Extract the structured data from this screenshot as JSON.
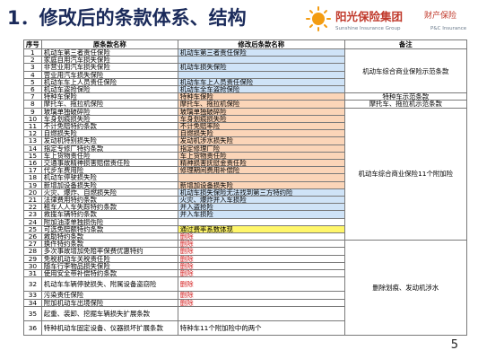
{
  "slide": {
    "title": "1．修改后的条款体系、结构",
    "page_number": "5"
  },
  "logo": {
    "name_cn": "阳光保险集团",
    "sub_cn": "财产保险",
    "name_en": "Sunshine Insurance Group",
    "sub_en": "P&C Insurance",
    "colors": {
      "red": "#c0392b",
      "orange": "#f39c12"
    }
  },
  "table": {
    "headers": [
      "序号",
      "原条款名称",
      "修改后条款名称",
      "备注"
    ],
    "rows": [
      {
        "num": "1",
        "orig": "机动车第三者责任保险",
        "new": "机动车第三者责任保险",
        "style": "blue"
      },
      {
        "num": "2",
        "orig": "家庭自用汽车损失保险",
        "new": "",
        "style": "blue"
      },
      {
        "num": "3",
        "orig": "非营业用汽车损失保险",
        "new": "机动车损失保险",
        "style": "blue"
      },
      {
        "num": "4",
        "orig": "营业用汽车损失保险",
        "new": "",
        "style": "blue"
      },
      {
        "num": "5",
        "orig": "机动车车上人员责任保险",
        "new": "机动车车上人员责任保险",
        "style": "blue"
      },
      {
        "num": "6",
        "orig": "机动车盗抢保险",
        "new": "机动车全车盗抢保险",
        "style": "blue"
      },
      {
        "num": "7",
        "orig": "特种车保险",
        "new": "特种车保险",
        "style": "peach"
      },
      {
        "num": "8",
        "orig": "摩托车、拖拉机保险",
        "new": "摩托车、拖拉机保险",
        "style": "peach"
      },
      {
        "num": "9",
        "orig": "玻璃单独破碎险",
        "new": "玻璃单独破碎险",
        "style": "peach"
      },
      {
        "num": "10",
        "orig": "车身划痕损失险",
        "new": "车身划痕损失险",
        "style": "peach"
      },
      {
        "num": "11",
        "orig": "不计免赔特约条款",
        "new": "不计免赔率险",
        "style": "peach"
      },
      {
        "num": "12",
        "orig": "自燃损失险",
        "new": "自燃损失险",
        "style": "peach"
      },
      {
        "num": "13",
        "orig": "发动机特别损失险",
        "new": "发动机涉水损失险",
        "style": "peach"
      },
      {
        "num": "14",
        "orig": "指定专修厂特约条款",
        "new": "指定修理厂险",
        "style": "peach"
      },
      {
        "num": "15",
        "orig": "车上货物责任险",
        "new": "车上货物责任险",
        "style": "peach"
      },
      {
        "num": "16",
        "orig": "交通事故精神损害赔偿责任险",
        "new": "精神损害抚慰金责任险",
        "style": "peach"
      },
      {
        "num": "17",
        "orig": "代步车费用险",
        "new": "修理期间费用补偿险",
        "style": "peach"
      },
      {
        "num": "18",
        "orig": "机动车停驶损失险",
        "new": "",
        "style": "peach"
      },
      {
        "num": "19",
        "orig": "新增加设备损失险",
        "new": "新增加设备损失险",
        "style": "peach"
      },
      {
        "num": "20",
        "orig": "火灾、爆炸、自燃损失险",
        "new": "机动车损失保险无法找到第三方特约险",
        "style": "blue"
      },
      {
        "num": "21",
        "orig": "法律费用特约条款",
        "new": "火灾、爆炸并入车损险",
        "style": "blue"
      },
      {
        "num": "22",
        "orig": "租车人人车失踪特约条款",
        "new": "并入盗抢险",
        "style": "blue"
      },
      {
        "num": "23",
        "orig": "救援车辆特约条款",
        "new": "并入车损险",
        "style": "blue"
      },
      {
        "num": "24",
        "orig": "附加油漆单独损伤险",
        "new": "",
        "style": "none"
      },
      {
        "num": "25",
        "orig": "可选免赔额特约条款",
        "new": "通过费率系数体现",
        "style": "yellow"
      },
      {
        "num": "26",
        "orig": "救助特约条款",
        "new": "删除",
        "style": "del"
      },
      {
        "num": "27",
        "orig": "换件特约条款",
        "new": "删除",
        "style": "del"
      },
      {
        "num": "28",
        "orig": "多次事故增加免赔率保费优惠特约",
        "new": "删除",
        "style": "del"
      },
      {
        "num": "29",
        "orig": "免税机动车关税责任险",
        "new": "删除",
        "style": "del"
      },
      {
        "num": "30",
        "orig": "随车行李物品损失保险",
        "new": "删除",
        "style": "del"
      },
      {
        "num": "31",
        "orig": "使用安全带补偿特约条款",
        "new": "删除",
        "style": "del"
      },
      {
        "num": "32",
        "orig": "机动车车辆停驶损失、附属设备盗窃险",
        "new": "删除",
        "style": "del"
      },
      {
        "num": "33",
        "orig": "污染责任保险",
        "new": "删除",
        "style": "del"
      },
      {
        "num": "34",
        "orig": "附加机动车出境保险",
        "new": "删除",
        "style": "del"
      },
      {
        "num": "35",
        "orig": "起重、装卸、挖掘车辆损失扩展条款",
        "new": "",
        "style": "none"
      },
      {
        "num": "36",
        "orig": "特种机动车固定设备、仪器损坏扩展条款",
        "new": "特种车11个附加险中的两个",
        "style": "none"
      }
    ],
    "remarks": {
      "r1": "机动车综合商业保险示范条款",
      "r2": "特种车示范条款",
      "r3": "摩托车、拖拉机示范条款",
      "r4": "机动车综合商业保险11个附加险",
      "r5": "删除划痕、发动机涉水"
    }
  }
}
